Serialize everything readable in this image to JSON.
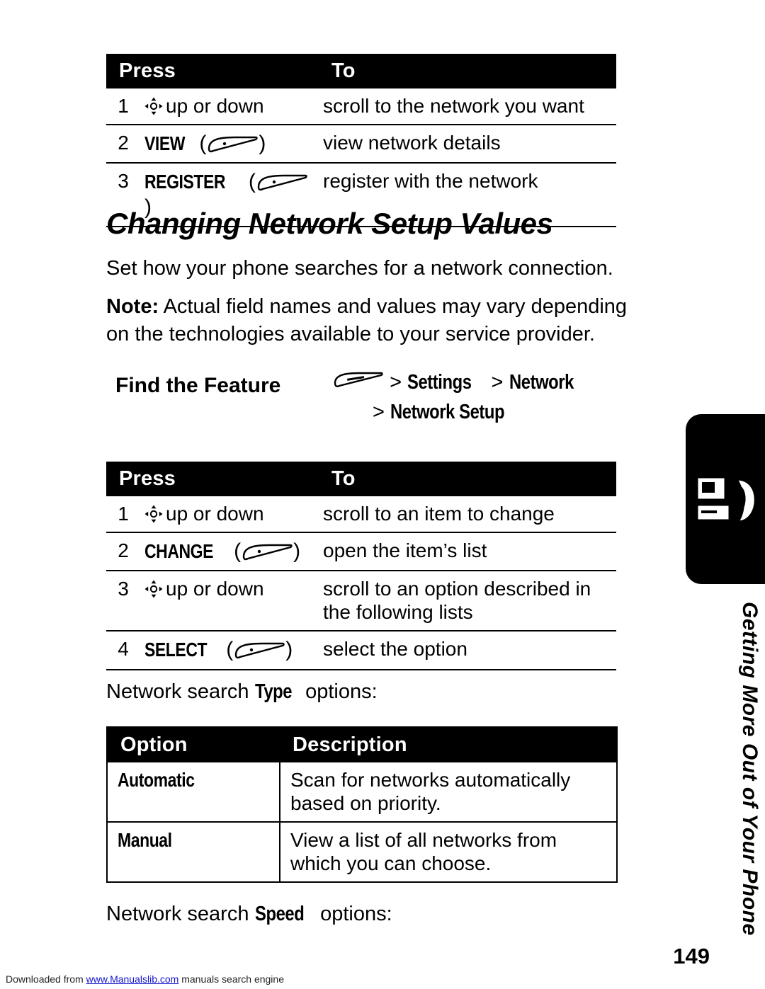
{
  "top_table": {
    "headers": [
      "Press",
      "To"
    ],
    "rows": [
      {
        "num": "1",
        "press_icon": "nav-key-icon",
        "press_text": "up or down",
        "to": "scroll to the network you want"
      },
      {
        "num": "2",
        "press_text": "VIEW",
        "press_icon": "softkey-icon",
        "to": "view network details"
      },
      {
        "num": "3",
        "press_text": "REGISTER",
        "press_icon": "softkey-icon",
        "to": "register with the network"
      }
    ]
  },
  "heading": "Changing Network Setup Values",
  "intro": "Set how your phone searches for a network connection.",
  "note": {
    "label": "Note:",
    "text": " Actual field names and values may vary depending on the technologies available to your service provider."
  },
  "find_the_feature": {
    "label": "Find the Feature",
    "line1_prefix": ">",
    "line1_items": [
      "Settings",
      "Network"
    ],
    "line2_prefix": ">",
    "line2_items": [
      "Network Setup"
    ],
    "separator": ">"
  },
  "second_table": {
    "headers": [
      "Press",
      "To"
    ],
    "rows": [
      {
        "num": "1",
        "press_icon": "nav-key-icon",
        "press_text": "up or down",
        "to": "scroll to an item to change"
      },
      {
        "num": "2",
        "press_text": "CHANGE",
        "press_icon": "softkey-icon",
        "to": "open the item’s list"
      },
      {
        "num": "3",
        "press_icon": "nav-key-icon",
        "press_text": "up or down",
        "to": "scroll to an option described in the following lists"
      },
      {
        "num": "4",
        "press_text": "SELECT",
        "press_icon": "softkey-icon",
        "to": "select the option"
      }
    ]
  },
  "type_caption": {
    "before": "Network search ",
    "keyword": "Type",
    "after": " options:"
  },
  "options_table": {
    "headers": [
      "Option",
      "Description"
    ],
    "rows": [
      {
        "option": "Automatic",
        "description": "Scan for networks automatically based on priority."
      },
      {
        "option": "Manual",
        "description": "View a list of all networks from which you can choose."
      }
    ]
  },
  "speed_caption": {
    "before": "Network search ",
    "keyword": "Speed",
    "after": " options:"
  },
  "side_tab_text": "Getting More Out of Your Phone",
  "page_number": "149",
  "footer": {
    "before": "Downloaded from ",
    "link": "www.Manualslib.com",
    "after": " manuals search engine"
  }
}
